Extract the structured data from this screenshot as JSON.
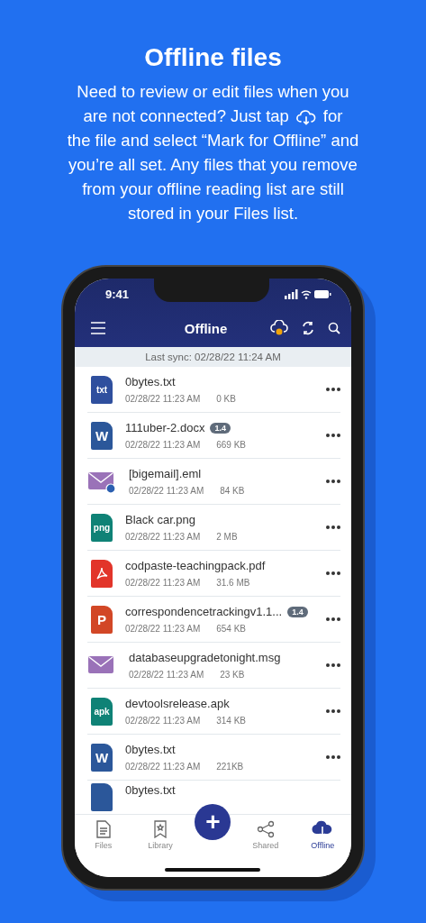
{
  "heading": "Offline files",
  "description_lines": [
    [
      "Need to review or edit files when you"
    ],
    [
      "are not connected? Just tap",
      "for"
    ],
    [
      "the file and select “Mark for Offline” and"
    ],
    [
      "you’re all set. Any files that you remove"
    ],
    [
      "from your offline reading list are still"
    ],
    [
      "stored in your Files list."
    ]
  ],
  "status_bar": {
    "time": "9:41"
  },
  "toolbar": {
    "title": "Offline"
  },
  "sync": "Last sync: 02/28/22 11:24 AM",
  "files": [
    {
      "kind": "txt",
      "icon_text": "txt",
      "name": "0bytes.txt",
      "date": "02/28/22 11:23 AM",
      "size": "0 KB"
    },
    {
      "kind": "word",
      "icon_text": "W",
      "name": "111uber-2.docx",
      "version": "1.4",
      "date": "02/28/22 11:23 AM",
      "size": "669 KB"
    },
    {
      "kind": "email",
      "attachment": true,
      "name": "[bigemail].eml",
      "date": "02/28/22 11:23 AM",
      "size": "84 KB"
    },
    {
      "kind": "png",
      "icon_text": "png",
      "name": "Black car.png",
      "date": "02/28/22 11:23 AM",
      "size": "2 MB"
    },
    {
      "kind": "pdf",
      "name": "codpaste-teachingpack.pdf",
      "date": "02/28/22 11:23 AM",
      "size": "31.6 MB"
    },
    {
      "kind": "ppt",
      "icon_text": "P",
      "name": "correspondencetrackingv1.1...",
      "version": "1.4",
      "date": "02/28/22 11:23 AM",
      "size": "654 KB"
    },
    {
      "kind": "email",
      "attachment": false,
      "name": "databaseupgradetonight.msg",
      "date": "02/28/22 11:23 AM",
      "size": "23 KB"
    },
    {
      "kind": "apk",
      "icon_text": "apk",
      "name": "devtoolsrelease.apk",
      "date": "02/28/22 11:23 AM",
      "size": "314 KB"
    },
    {
      "kind": "word",
      "icon_text": "W",
      "name": "0bytes.txt",
      "date": "02/28/22 11:23 AM",
      "size": "221KB"
    },
    {
      "kind": "word",
      "name": "0bytes.txt"
    }
  ],
  "tabs": [
    {
      "kind": "files",
      "label": "Files",
      "selected": false
    },
    {
      "kind": "library",
      "label": "Library",
      "selected": false
    },
    {
      "kind": "fab",
      "label": "+"
    },
    {
      "kind": "shared",
      "label": "Shared",
      "selected": false
    },
    {
      "kind": "offline",
      "label": "Offline",
      "selected": true
    }
  ]
}
